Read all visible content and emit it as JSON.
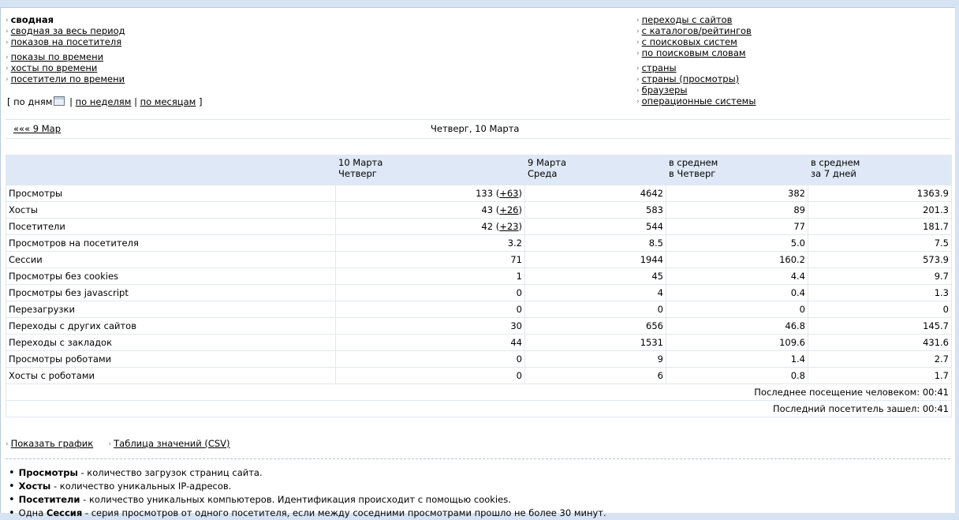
{
  "menu_left": {
    "items": [
      {
        "label": "сводная",
        "current": true
      },
      {
        "label": "сводная за весь период"
      },
      {
        "label": "показов на посетителя"
      },
      {
        "label": "показы по времени"
      },
      {
        "label": "хосты по времени"
      },
      {
        "label": "посетители по времени"
      }
    ]
  },
  "menu_right": {
    "items": [
      {
        "label": "переходы с сайтов"
      },
      {
        "label": "с каталогов/рейтингов"
      },
      {
        "label": "с поисковых систем"
      },
      {
        "label": "по поисковым словам"
      },
      {
        "label": "страны"
      },
      {
        "label": "страны (просмотры)"
      },
      {
        "label": "браузеры"
      },
      {
        "label": "операционные системы"
      }
    ]
  },
  "periods": {
    "open": "[",
    "by_days": "по дням",
    "sep": "|",
    "by_weeks": "по неделям",
    "by_months": "по месяцам",
    "close": "]"
  },
  "nav": {
    "prev_day": "««« 9 Мар",
    "title": "Четверг, 10 Марта"
  },
  "table": {
    "columns": [
      {
        "line1": "",
        "line2": ""
      },
      {
        "line1": "10 Марта",
        "line2": "Четверг"
      },
      {
        "line1": "9 Марта",
        "line2": "Среда"
      },
      {
        "line1": "в среднем",
        "line2": "в Четверг"
      },
      {
        "line1": "в среднем",
        "line2": "за 7 дней"
      }
    ],
    "rows": [
      {
        "label": "Просмотры",
        "today": "133",
        "delta": "+63",
        "prev": "4642",
        "avg_thu": "382",
        "avg_7": "1363.9"
      },
      {
        "label": "Хосты",
        "today": "43",
        "delta": "+26",
        "prev": "583",
        "avg_thu": "89",
        "avg_7": "201.3"
      },
      {
        "label": "Посетители",
        "today": "42",
        "delta": "+23",
        "prev": "544",
        "avg_thu": "77",
        "avg_7": "181.7"
      },
      {
        "label": "Просмотров на посетителя",
        "today": "3.2",
        "prev": "8.5",
        "avg_thu": "5.0",
        "avg_7": "7.5"
      },
      {
        "label": "Сессии",
        "today": "71",
        "prev": "1944",
        "avg_thu": "160.2",
        "avg_7": "573.9"
      },
      {
        "label": "Просмотры без cookies",
        "today": "1",
        "prev": "45",
        "avg_thu": "4.4",
        "avg_7": "9.7"
      },
      {
        "label": "Просмотры без javascript",
        "today": "0",
        "prev": "4",
        "avg_thu": "0.4",
        "avg_7": "1.3"
      },
      {
        "label": "Перезагрузки",
        "today": "0",
        "prev": "0",
        "avg_thu": "0",
        "avg_7": "0"
      },
      {
        "label": "Переходы с других сайтов",
        "today": "30",
        "prev": "656",
        "avg_thu": "46.8",
        "avg_7": "145.7"
      },
      {
        "label": "Переходы с закладок",
        "today": "44",
        "prev": "1531",
        "avg_thu": "109.6",
        "avg_7": "431.6"
      },
      {
        "label": "Просмотры роботами",
        "today": "0",
        "prev": "9",
        "avg_thu": "1.4",
        "avg_7": "2.7"
      },
      {
        "label": "Хосты с роботами",
        "today": "0",
        "prev": "6",
        "avg_thu": "0.8",
        "avg_7": "1.7"
      }
    ],
    "footer": [
      "Последнее посещение человеком: 00:41",
      "Последний посетитель зашел: 00:41"
    ]
  },
  "links": {
    "show_chart": "Показать график",
    "csv_table": "Таблица значений (CSV)"
  },
  "notes": [
    {
      "term": "Просмотры",
      "text": " - количество загрузок страниц сайта."
    },
    {
      "term": "Хосты",
      "text": " - количество уникальных IP-адресов."
    },
    {
      "term": "Посетители",
      "text": " - количество уникальных компьютеров. Идентификация происходит с помощью cookies."
    },
    {
      "prefix": "Одна ",
      "term": "Сессия",
      "text": " - серия просмотров от одного посетителя, если между соседними просмотрами прошло не более 30 минут."
    }
  ],
  "colors": {
    "page_bg": "#d7e3f3",
    "header_bg": "#dfe8f6",
    "cell_border": "#e1e8f1"
  },
  "icons": {
    "menu_bullet": "chevron-right-icon",
    "calendar": "calendar-icon",
    "note_bullet": "bullet-dot-icon"
  }
}
